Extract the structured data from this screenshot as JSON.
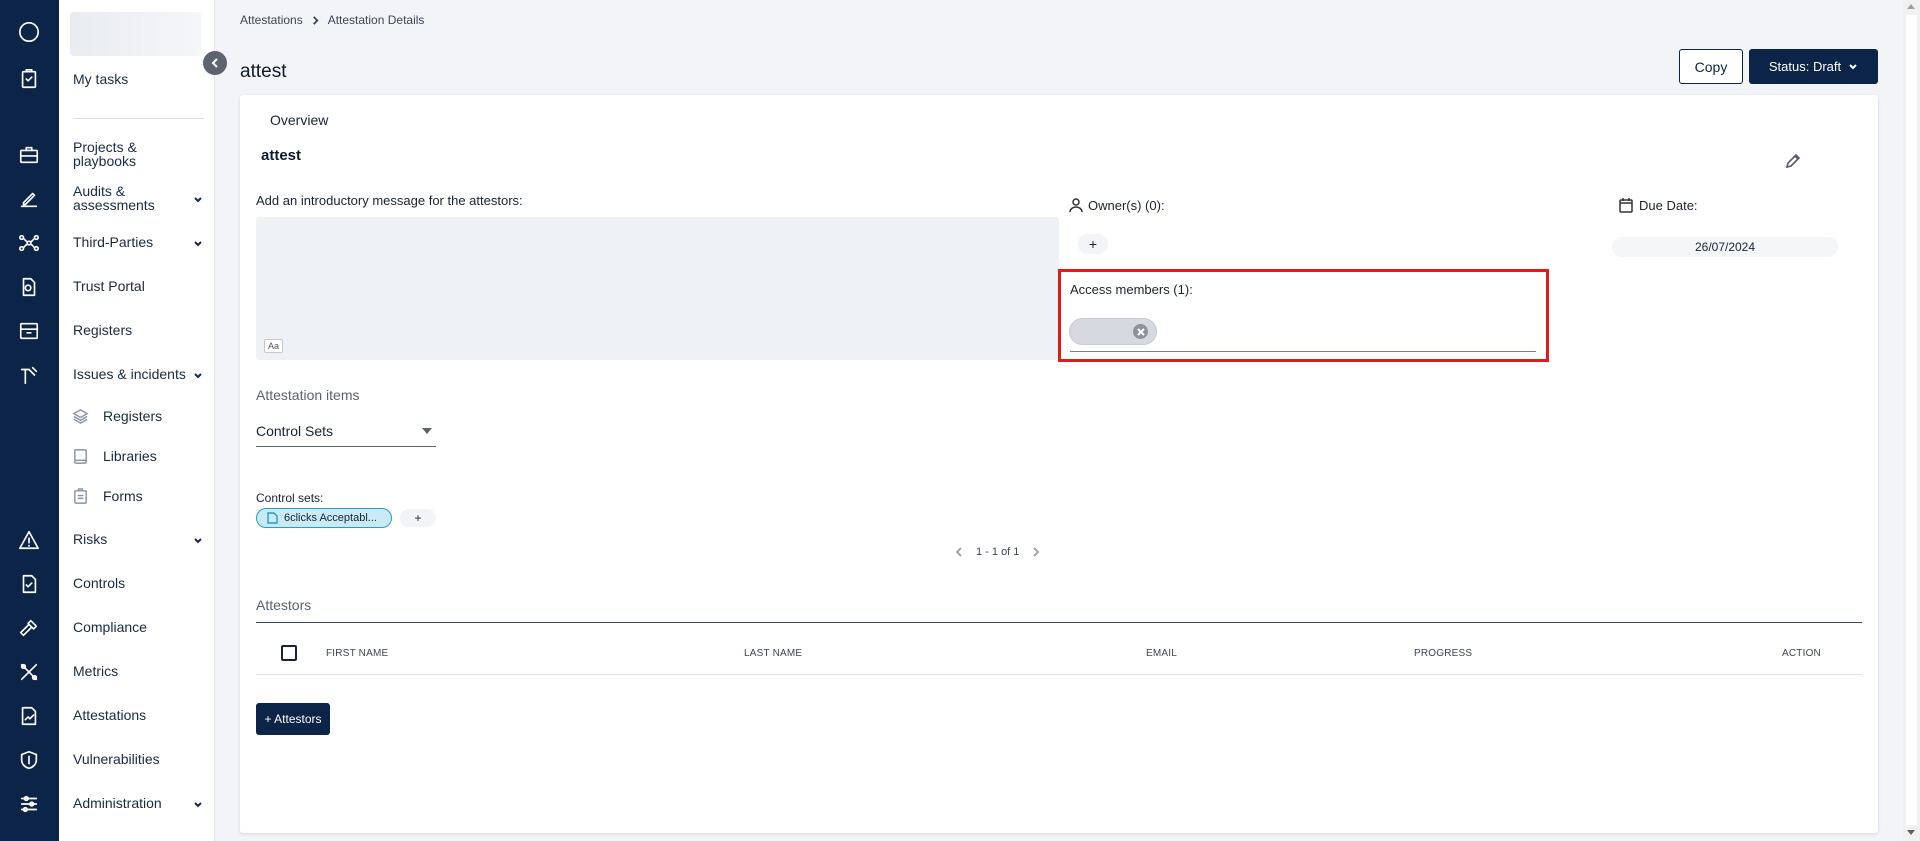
{
  "breadcrumb": {
    "root": "Attestations",
    "current": "Attestation Details"
  },
  "page": {
    "title": "attest"
  },
  "header_buttons": {
    "copy": "Copy",
    "status": "Status: Draft"
  },
  "sidebar": {
    "items": [
      {
        "label": "My tasks",
        "has_children": false
      },
      {
        "label": "Projects &\nplaybooks",
        "has_children": false
      },
      {
        "label": "Audits &\nassessments",
        "has_children": true
      },
      {
        "label": "Third-Parties",
        "has_children": true
      },
      {
        "label": "Trust Portal",
        "has_children": false
      },
      {
        "label": "Registers",
        "has_children": false
      },
      {
        "label": "Issues & incidents",
        "has_children": true
      },
      {
        "label": "Risks",
        "has_children": true
      },
      {
        "label": "Controls",
        "has_children": false
      },
      {
        "label": "Compliance",
        "has_children": false
      },
      {
        "label": "Metrics",
        "has_children": false
      },
      {
        "label": "Attestations",
        "has_children": false
      },
      {
        "label": "Vulnerabilities",
        "has_children": false
      },
      {
        "label": "Administration",
        "has_children": true
      }
    ],
    "sub_items": [
      {
        "label": "Registers",
        "icon": "layers-icon"
      },
      {
        "label": "Libraries",
        "icon": "book-icon"
      },
      {
        "label": "Forms",
        "icon": "clipboard-icon"
      }
    ]
  },
  "overview": {
    "tab": "Overview",
    "title": "attest",
    "intro_label": "Add an introductory message for the attestors:",
    "intro_format_button": "Aa",
    "owners_label": "Owner(s) (0):",
    "owners_add": "+",
    "due_label": "Due Date:",
    "due_value": "26/07/2024",
    "access_label": "Access members (1):"
  },
  "attestation_items": {
    "label": "Attestation items",
    "select_value": "Control Sets",
    "control_sets_label": "Control sets:",
    "control_set_chip": "6clicks Acceptabl...",
    "add": "+",
    "pagination": "1 - 1 of 1"
  },
  "attestors": {
    "label": "Attestors",
    "columns": [
      "FIRST NAME",
      "LAST NAME",
      "EMAIL",
      "PROGRESS",
      "ACTION"
    ],
    "add_button": "+ Attestors"
  },
  "colors": {
    "navy": "#0b2447",
    "highlight": "#e01b1b",
    "chip": "#c9eaf7"
  }
}
